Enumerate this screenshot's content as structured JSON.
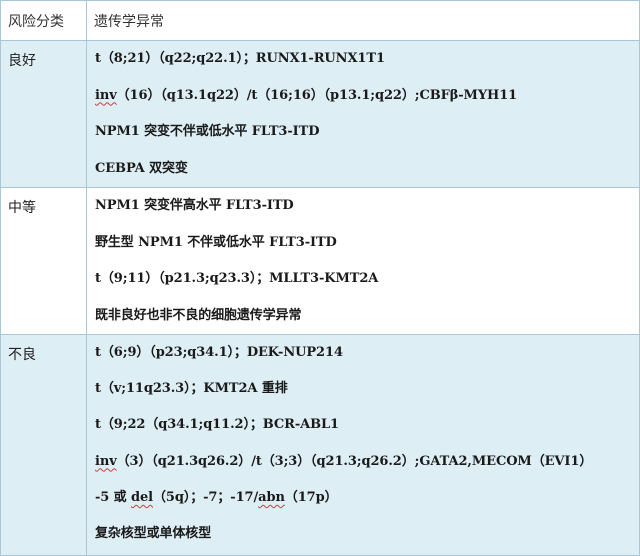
{
  "table": {
    "headers": {
      "category": "风险分类",
      "abnormality": "遗传学异常"
    },
    "groups": [
      {
        "category": "良好",
        "items": [
          [
            "t（8;21）（q22;q22.1）；RUNX1-RUNX1T1"
          ],
          [
            "inv",
            "（16）（q13.1q22）/t（16;16）（p13.1;q22）;CBFβ-MYH11"
          ],
          [
            "NPM1 突变不伴或低水平 FLT3-ITD"
          ],
          [
            "CEBPA 双突变"
          ]
        ]
      },
      {
        "category": "中等",
        "items": [
          [
            "NPM1 突变伴高水平 FLT3-ITD"
          ],
          [
            "野生型 NPM1 不伴或低水平 FLT3-ITD"
          ],
          [
            "t（9;11）（p21.3;q23.3）；MLLT3-KMT2A"
          ],
          [
            "既非良好也非不良的细胞遗传学异常"
          ]
        ]
      },
      {
        "category": "不良",
        "items": [
          [
            "t（6;9）（p23;q34.1）；DEK-NUP214"
          ],
          [
            "t（v;11q23.3）；KMT2A 重排"
          ],
          [
            "t（9;22（q34.1;q11.2）；BCR-ABL1"
          ],
          [
            "inv",
            "（3）（q21.3q26.2）/t（3;3）（q21.3;q26.2）;GATA2,MECOM（EVI1）"
          ],
          [
            "-5 或 ",
            "del",
            "（5q）；-7；-17/",
            "abn",
            "（17p）"
          ],
          [
            "复杂核型或单体核型"
          ]
        ]
      }
    ]
  }
}
